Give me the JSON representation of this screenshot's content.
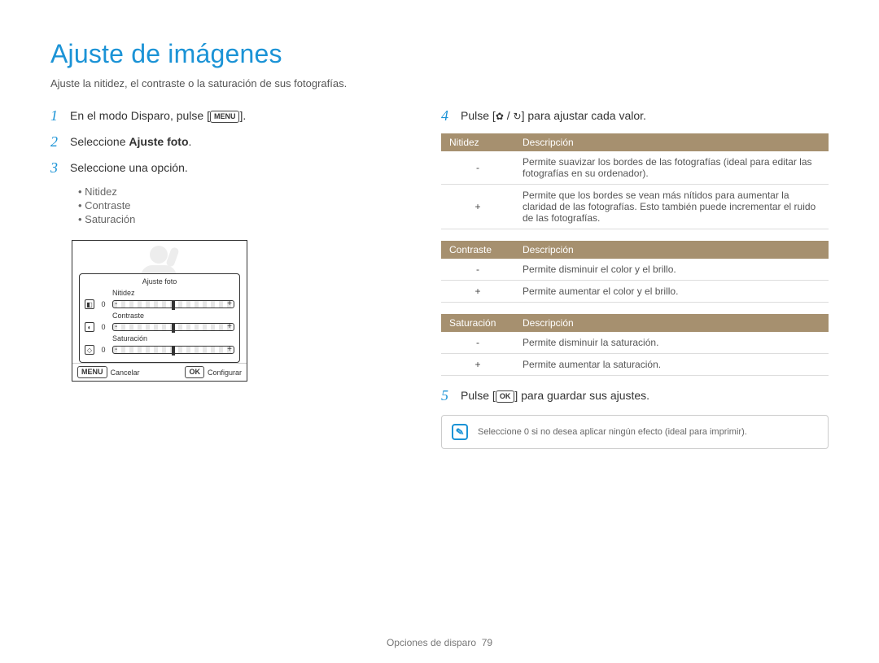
{
  "title": "Ajuste de imágenes",
  "subtitle": "Ajuste la nitidez, el contraste o la saturación de sus fotografías.",
  "left": {
    "step1_pre": "En el modo Disparo, pulse [",
    "step1_btn": "MENU",
    "step1_post": "].",
    "step2_pre": "Seleccione ",
    "step2_bold": "Ajuste foto",
    "step2_post": ".",
    "step3": "Seleccione una opción.",
    "bullets": [
      "Nitidez",
      "Contraste",
      "Saturación"
    ],
    "screen": {
      "title": "Ajuste foto",
      "rows": [
        {
          "icon": "◧",
          "val": "0",
          "label": "Nitidez"
        },
        {
          "icon": "◐",
          "val": "0",
          "label": "Contraste"
        },
        {
          "icon": "◇",
          "val": "0",
          "label": "Saturación"
        }
      ],
      "footer_left_btn": "MENU",
      "footer_left": "Cancelar",
      "footer_right_btn": "OK",
      "footer_right": "Configurar"
    }
  },
  "right": {
    "step4_pre": "Pulse [",
    "step4_icon1": "✿",
    "step4_sep": " / ",
    "step4_icon2": "↻",
    "step4_post": "] para ajustar cada valor.",
    "tables": [
      {
        "h1": "Nitidez",
        "h2": "Descripción",
        "rows": [
          {
            "k": "-",
            "v": "Permite suavizar los bordes de las fotografías (ideal para editar las fotografías en su ordenador)."
          },
          {
            "k": "+",
            "v": "Permite que los bordes se vean más nítidos para aumentar la claridad de las fotografías. Esto también puede incrementar el ruido de las fotografías."
          }
        ]
      },
      {
        "h1": "Contraste",
        "h2": "Descripción",
        "rows": [
          {
            "k": "-",
            "v": "Permite disminuir el color y el brillo."
          },
          {
            "k": "+",
            "v": "Permite aumentar el color y el brillo."
          }
        ]
      },
      {
        "h1": "Saturación",
        "h2": "Descripción",
        "rows": [
          {
            "k": "-",
            "v": "Permite disminuir la saturación."
          },
          {
            "k": "+",
            "v": "Permite aumentar la saturación."
          }
        ]
      }
    ],
    "step5_pre": "Pulse [",
    "step5_btn": "OK",
    "step5_post": "] para guardar sus ajustes.",
    "note": "Seleccione 0 si no desea aplicar ningún efecto (ideal para imprimir)."
  },
  "footer_section": "Opciones de disparo",
  "footer_page": "79"
}
